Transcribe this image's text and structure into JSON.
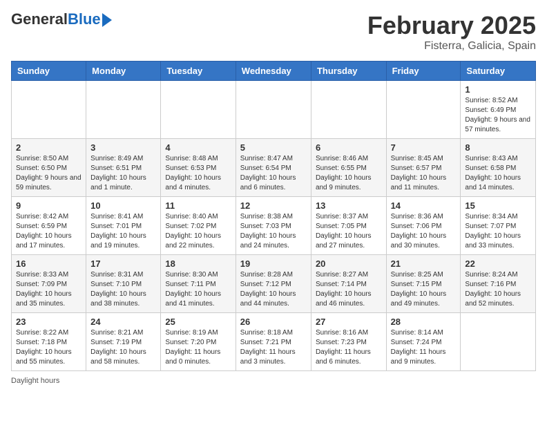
{
  "header": {
    "logo_line1": "General",
    "logo_line2": "Blue",
    "title": "February 2025",
    "subtitle": "Fisterra, Galicia, Spain"
  },
  "weekdays": [
    "Sunday",
    "Monday",
    "Tuesday",
    "Wednesday",
    "Thursday",
    "Friday",
    "Saturday"
  ],
  "weeks": [
    [
      {
        "day": "",
        "info": ""
      },
      {
        "day": "",
        "info": ""
      },
      {
        "day": "",
        "info": ""
      },
      {
        "day": "",
        "info": ""
      },
      {
        "day": "",
        "info": ""
      },
      {
        "day": "",
        "info": ""
      },
      {
        "day": "1",
        "info": "Sunrise: 8:52 AM\nSunset: 6:49 PM\nDaylight: 9 hours and 57 minutes."
      }
    ],
    [
      {
        "day": "2",
        "info": "Sunrise: 8:50 AM\nSunset: 6:50 PM\nDaylight: 9 hours and 59 minutes."
      },
      {
        "day": "3",
        "info": "Sunrise: 8:49 AM\nSunset: 6:51 PM\nDaylight: 10 hours and 1 minute."
      },
      {
        "day": "4",
        "info": "Sunrise: 8:48 AM\nSunset: 6:53 PM\nDaylight: 10 hours and 4 minutes."
      },
      {
        "day": "5",
        "info": "Sunrise: 8:47 AM\nSunset: 6:54 PM\nDaylight: 10 hours and 6 minutes."
      },
      {
        "day": "6",
        "info": "Sunrise: 8:46 AM\nSunset: 6:55 PM\nDaylight: 10 hours and 9 minutes."
      },
      {
        "day": "7",
        "info": "Sunrise: 8:45 AM\nSunset: 6:57 PM\nDaylight: 10 hours and 11 minutes."
      },
      {
        "day": "8",
        "info": "Sunrise: 8:43 AM\nSunset: 6:58 PM\nDaylight: 10 hours and 14 minutes."
      }
    ],
    [
      {
        "day": "9",
        "info": "Sunrise: 8:42 AM\nSunset: 6:59 PM\nDaylight: 10 hours and 17 minutes."
      },
      {
        "day": "10",
        "info": "Sunrise: 8:41 AM\nSunset: 7:01 PM\nDaylight: 10 hours and 19 minutes."
      },
      {
        "day": "11",
        "info": "Sunrise: 8:40 AM\nSunset: 7:02 PM\nDaylight: 10 hours and 22 minutes."
      },
      {
        "day": "12",
        "info": "Sunrise: 8:38 AM\nSunset: 7:03 PM\nDaylight: 10 hours and 24 minutes."
      },
      {
        "day": "13",
        "info": "Sunrise: 8:37 AM\nSunset: 7:05 PM\nDaylight: 10 hours and 27 minutes."
      },
      {
        "day": "14",
        "info": "Sunrise: 8:36 AM\nSunset: 7:06 PM\nDaylight: 10 hours and 30 minutes."
      },
      {
        "day": "15",
        "info": "Sunrise: 8:34 AM\nSunset: 7:07 PM\nDaylight: 10 hours and 33 minutes."
      }
    ],
    [
      {
        "day": "16",
        "info": "Sunrise: 8:33 AM\nSunset: 7:09 PM\nDaylight: 10 hours and 35 minutes."
      },
      {
        "day": "17",
        "info": "Sunrise: 8:31 AM\nSunset: 7:10 PM\nDaylight: 10 hours and 38 minutes."
      },
      {
        "day": "18",
        "info": "Sunrise: 8:30 AM\nSunset: 7:11 PM\nDaylight: 10 hours and 41 minutes."
      },
      {
        "day": "19",
        "info": "Sunrise: 8:28 AM\nSunset: 7:12 PM\nDaylight: 10 hours and 44 minutes."
      },
      {
        "day": "20",
        "info": "Sunrise: 8:27 AM\nSunset: 7:14 PM\nDaylight: 10 hours and 46 minutes."
      },
      {
        "day": "21",
        "info": "Sunrise: 8:25 AM\nSunset: 7:15 PM\nDaylight: 10 hours and 49 minutes."
      },
      {
        "day": "22",
        "info": "Sunrise: 8:24 AM\nSunset: 7:16 PM\nDaylight: 10 hours and 52 minutes."
      }
    ],
    [
      {
        "day": "23",
        "info": "Sunrise: 8:22 AM\nSunset: 7:18 PM\nDaylight: 10 hours and 55 minutes."
      },
      {
        "day": "24",
        "info": "Sunrise: 8:21 AM\nSunset: 7:19 PM\nDaylight: 10 hours and 58 minutes."
      },
      {
        "day": "25",
        "info": "Sunrise: 8:19 AM\nSunset: 7:20 PM\nDaylight: 11 hours and 0 minutes."
      },
      {
        "day": "26",
        "info": "Sunrise: 8:18 AM\nSunset: 7:21 PM\nDaylight: 11 hours and 3 minutes."
      },
      {
        "day": "27",
        "info": "Sunrise: 8:16 AM\nSunset: 7:23 PM\nDaylight: 11 hours and 6 minutes."
      },
      {
        "day": "28",
        "info": "Sunrise: 8:14 AM\nSunset: 7:24 PM\nDaylight: 11 hours and 9 minutes."
      },
      {
        "day": "",
        "info": ""
      }
    ]
  ],
  "footer": {
    "daylight_label": "Daylight hours"
  }
}
